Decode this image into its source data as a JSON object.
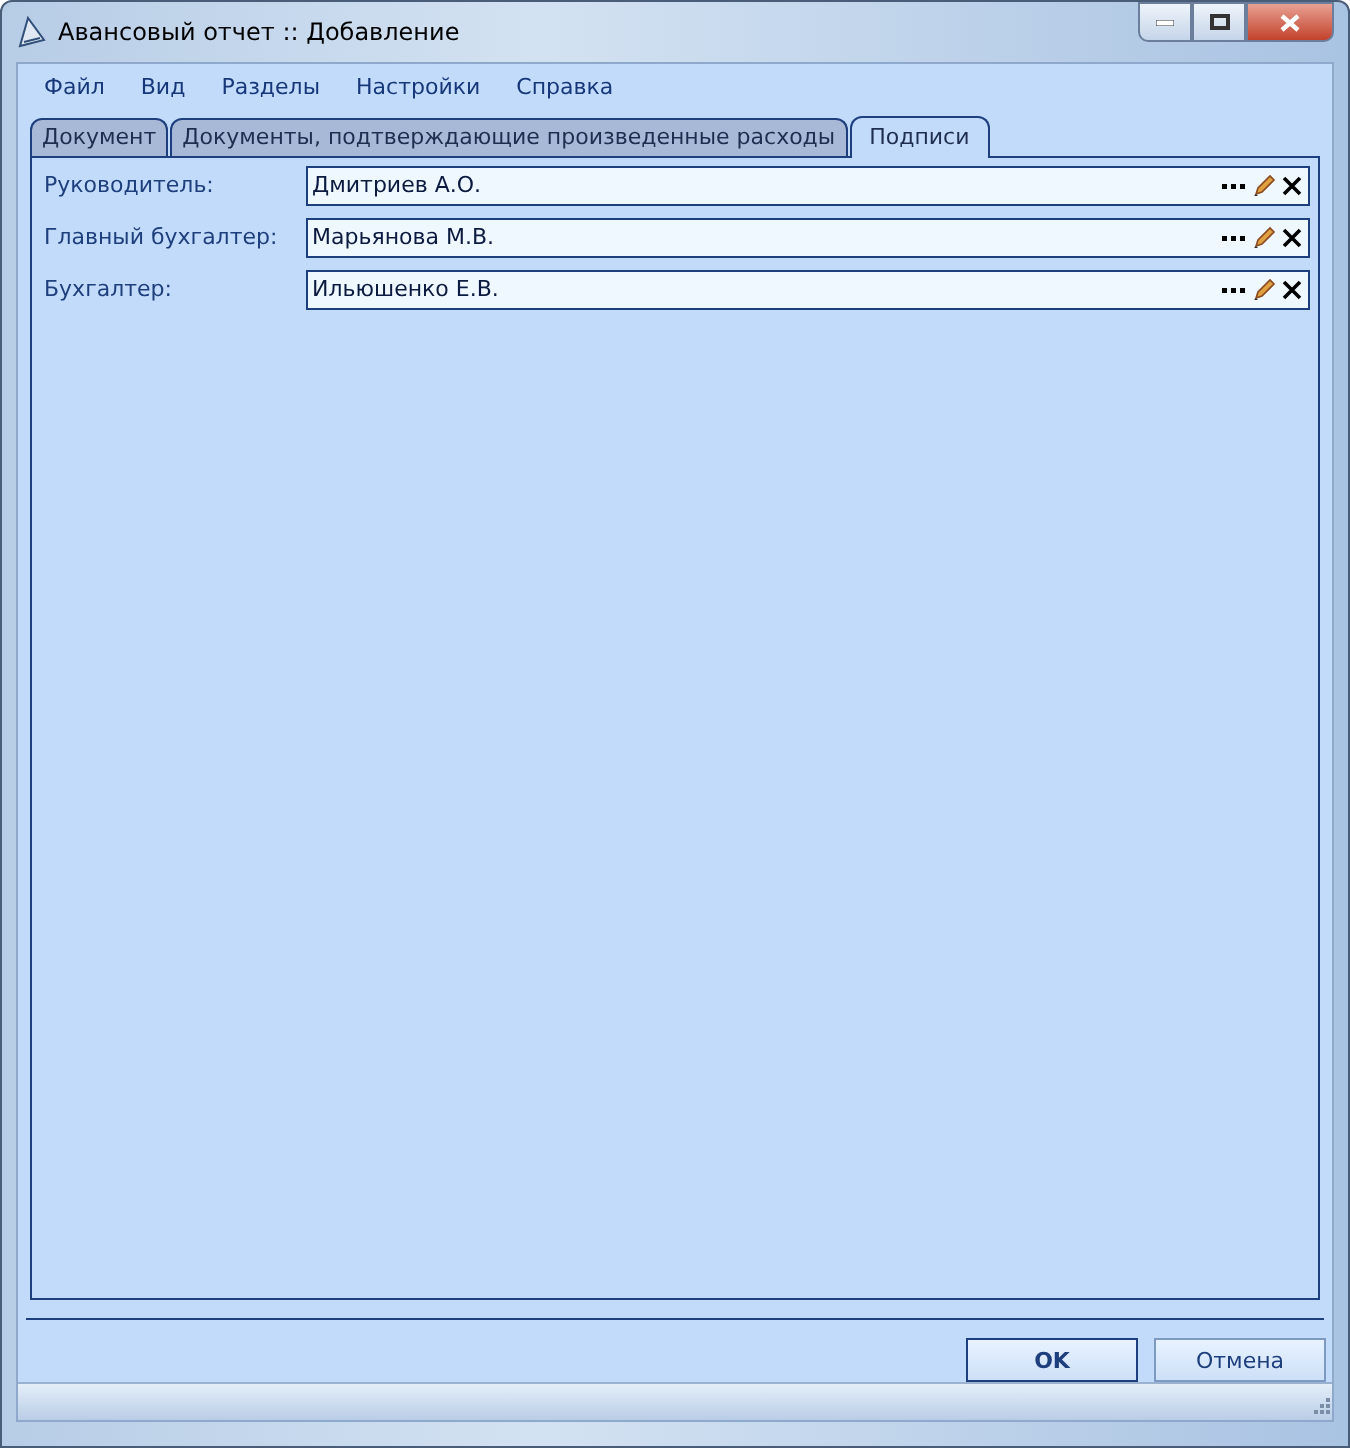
{
  "window": {
    "title": "Авансовый отчет :: Добавление"
  },
  "menu": [
    "Файл",
    "Вид",
    "Разделы",
    "Настройки",
    "Справка"
  ],
  "tabs": [
    {
      "label": "Документ",
      "selected": false
    },
    {
      "label": "Документы, подтверждающие произведенные расходы",
      "selected": false
    },
    {
      "label": "Подписи",
      "selected": true
    }
  ],
  "fields": [
    {
      "label": "Руководитель:",
      "value": "Дмитриев А.О."
    },
    {
      "label": "Главный бухгалтер:",
      "value": "Марьянова М.В."
    },
    {
      "label": "Бухгалтер:",
      "value": "Ильюшенко Е.В."
    }
  ],
  "buttons": [
    {
      "label": "OK",
      "kind": "default"
    },
    {
      "label": "Отмена",
      "kind": "normal"
    }
  ]
}
